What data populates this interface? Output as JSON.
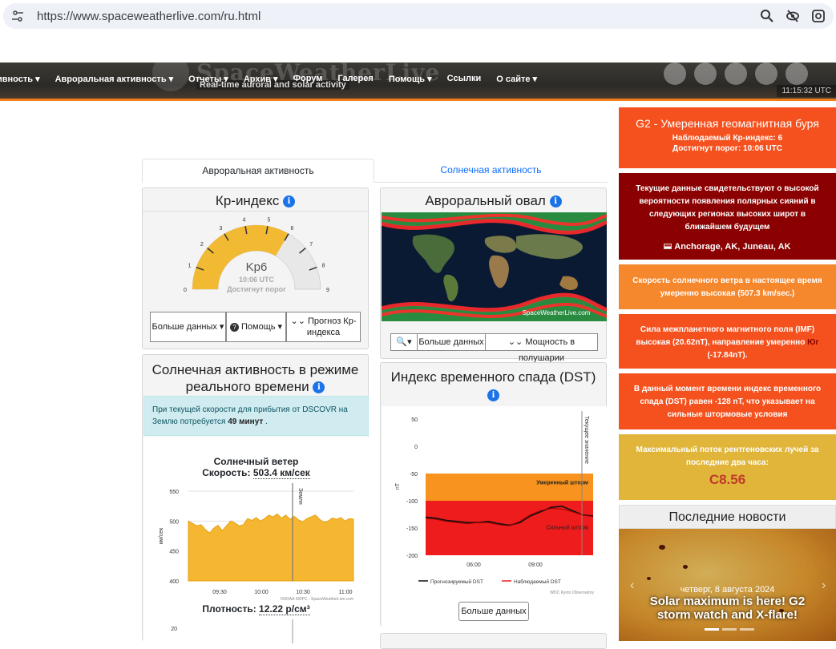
{
  "browser": {
    "url": "https://www.spaceweatherlive.com/ru.html"
  },
  "header": {
    "logo_text": "SpaceWeatherLive",
    "tagline": "Real-time auroral and solar activity",
    "clock": "11:15:32 UTC",
    "nav": [
      "ивность ▾",
      "Авроральная активность ▾",
      "Отчеты ▾",
      "Архив ▾",
      "Форум",
      "Галерея",
      "Помощь ▾",
      "Ссылки",
      "О сайте ▾"
    ]
  },
  "tabs": {
    "active": "Авроральная активность",
    "other": "Солнечная активность"
  },
  "kp": {
    "title": "Кp-индекс",
    "value_label": "Kp6",
    "time": "10:06 UTC",
    "status": "Достигнут порог",
    "kp_value": 6,
    "ticks": [
      "0",
      "1",
      "2",
      "3",
      "4",
      "5",
      "6",
      "7",
      "8",
      "9"
    ],
    "buttons": {
      "more": "Больше данных",
      "help": "Помощь",
      "forecast": "Прогноз Кр-индекса"
    }
  },
  "oval": {
    "title": "Авроральный овал",
    "watermark": "SpaceWeatherLive.com",
    "buttons": {
      "more": "Больше данных",
      "power": "Мощность в полушарии"
    }
  },
  "solar": {
    "title": "Солнечная активность в режиме реального времени",
    "notice_pre": "При текущей скорости для прибытия от DSCOVR на Землю потребуется",
    "notice_bold": "49 минут",
    "notice_post": ".",
    "wind_title": "Солнечный ветер",
    "speed_label": "Скорость:",
    "speed_value": "503.4 км/сек",
    "density_label": "Плотность:",
    "density_value": "12.22 р/см³",
    "delay_label": "Земля",
    "credit": "©NOAA SWPC - SpaceWeatherLive.com"
  },
  "dst": {
    "title": "Индекс временного спада (DST)",
    "zone_moderate": "Умеренный шторм",
    "zone_strong": "Сильный шторм",
    "now_label": "Текущее значение",
    "legend_forecast": "Прогнозируемый DST",
    "legend_observed": "Наблюдаемый DST",
    "credit": "WDC Kyoto Observatory",
    "more_button": "Больше данных"
  },
  "alerts": {
    "storm_title": "G2 - Умеренная геомагнитная буря",
    "storm_kp": "Наблюдаемый Кр-индекс: 6",
    "storm_time": "Достигнут порог: 10:06 UTC",
    "aurora_text": "Текущие данные свидетельствуют о высокой вероятности появления полярных сияний в следующих регионах высоких широт в ближайшем будущем",
    "aurora_places": "Anchorage, AK, Juneau, AK",
    "wind_text": "Скорость солнечного ветра в настоящее время умеренно высокая (507.3 km/sec.)",
    "imf_text": "Сила межпланетного магнитного поля (IMF) высокая (20.62nT), направление умеренно",
    "imf_dir": "Юг",
    "imf_value": "(-17.84nT).",
    "dst_text": "В данный момент времени индекс временного спада (DST) равен -128 nT, что указывает на сильные штормовые условия",
    "xray_text": "Максимальный поток рентгеновских лучей за последние два часа:",
    "xray_value": "C8.56"
  },
  "news": {
    "head": "Последние новости",
    "date": "четверг, 8 августа 2024",
    "title": "Solar maximum is here! G2 storm watch and X-flare!"
  },
  "chart_data": [
    {
      "type": "area",
      "title": "Солнечный ветер",
      "ylabel": "км/сек",
      "ylim": [
        400,
        550
      ],
      "yticks": [
        "550",
        "500",
        "450",
        "400"
      ],
      "x": [
        "09:30",
        "10:00",
        "10:30",
        "11:00"
      ],
      "series": [
        {
          "name": "Скорость",
          "values": [
            500,
            496,
            492,
            494,
            486,
            480,
            488,
            493,
            484,
            492,
            500,
            497,
            492,
            494,
            504,
            501,
            506,
            500,
            504,
            510,
            507,
            512,
            505,
            510,
            503,
            508,
            502,
            499,
            504,
            507,
            510,
            503,
            498,
            500,
            505,
            503,
            506,
            500,
            504,
            503
          ]
        }
      ]
    },
    {
      "type": "line",
      "title": "Индекс временного спада (DST)",
      "ylabel": "nT",
      "ylim": [
        -200,
        50
      ],
      "yticks": [
        "50",
        "0",
        "-50",
        "-100",
        "-150",
        "-200"
      ],
      "x": [
        "06:00",
        "09:00"
      ],
      "series": [
        {
          "name": "Прогнозируемый DST",
          "values": [
            -130,
            -132,
            -136,
            -138,
            -140,
            -140,
            -138,
            -142,
            -145,
            -140,
            -128,
            -120,
            -112,
            -110,
            -118,
            -126,
            -128
          ]
        },
        {
          "name": "Наблюдаемый DST",
          "values": [
            -132,
            -134,
            -138,
            -140,
            -142,
            -140,
            -140,
            -144,
            -146,
            -138,
            -126,
            -118,
            -114,
            -115,
            -120,
            -126,
            -129
          ]
        }
      ]
    },
    {
      "type": "gauge",
      "title": "Кp-индекс",
      "value": 6,
      "ylim": [
        0,
        9
      ]
    }
  ]
}
